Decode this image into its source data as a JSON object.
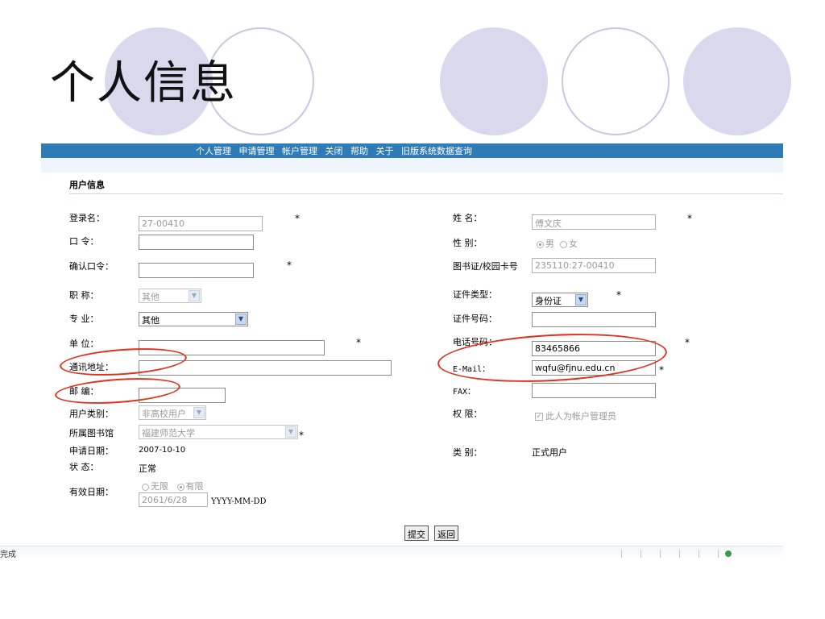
{
  "slide": {
    "title": "个人信息"
  },
  "nav": {
    "items": [
      "个人管理",
      "申请管理",
      "帐户管理",
      "关闭",
      "帮助",
      "关于",
      "旧版系统数据查询"
    ]
  },
  "section_title": "用户信息",
  "left_fields": {
    "login_name": {
      "label": "登录名：",
      "value": "27-00410"
    },
    "password": {
      "label": "口 令：",
      "value": ""
    },
    "confirm_password": {
      "label": "确认口令：",
      "value": ""
    },
    "title": {
      "label": "职 称：",
      "value": "其他"
    },
    "major": {
      "label": "专 业：",
      "value": "其他"
    },
    "unit": {
      "label": "单 位：",
      "value": ""
    },
    "address": {
      "label": "通讯地址：",
      "value": ""
    },
    "postcode": {
      "label": "邮 编：",
      "value": ""
    },
    "user_type": {
      "label": "用户类别：",
      "value": "非高校用户"
    },
    "library": {
      "label": "所属图书馆",
      "value": "福建师范大学"
    },
    "apply_date": {
      "label": "申请日期：",
      "value": "2007-10-10"
    },
    "status": {
      "label": "状 态：",
      "value": "正常"
    },
    "valid_date": {
      "label": "有效日期：",
      "option_unlimited": "无限",
      "option_limited": "有限",
      "value": "2061/6/28",
      "format_hint": "YYYY-MM-DD"
    }
  },
  "right_fields": {
    "name": {
      "label": "姓 名：",
      "value": "傅文庆"
    },
    "gender": {
      "label": "性 别：",
      "option_male": "男",
      "option_female": "女"
    },
    "card_no": {
      "label": "图书证/校园卡号",
      "value": "235110:27-00410"
    },
    "id_type": {
      "label": "证件类型：",
      "value": "身份证"
    },
    "id_number": {
      "label": "证件号码：",
      "value": ""
    },
    "phone": {
      "label": "电话号码：",
      "value": "83465866"
    },
    "email": {
      "label": "E-Mail：",
      "value": "wqfu@fjnu.edu.cn"
    },
    "fax": {
      "label": "FAX：",
      "value": ""
    },
    "permission": {
      "label": "权 限：",
      "checkbox_label": "此人为帐户管理员"
    },
    "category": {
      "label": "类 别：",
      "value": "正式用户"
    }
  },
  "required_mark": "*",
  "buttons": {
    "submit": "提交",
    "back": "返回"
  },
  "status_bar": {
    "text": "完成"
  },
  "colors": {
    "nav_bar": "#2f7bb5",
    "circle_fill": "#d9d9ee",
    "highlight_ellipse": "#e0311e"
  }
}
